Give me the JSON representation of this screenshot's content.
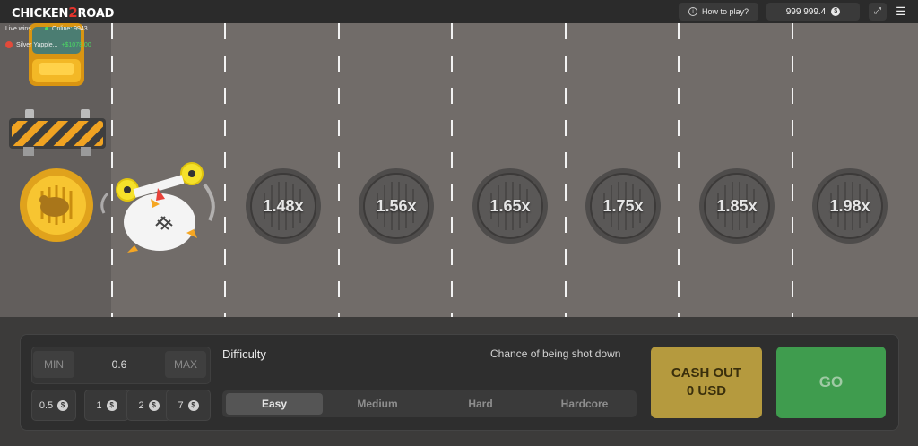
{
  "header": {
    "logo_part1": "CHICKEN",
    "logo_part2": "2",
    "logo_part3": "ROAD",
    "how_to_play": "How to play?",
    "balance": "999 999.4",
    "currency_symbol": "$"
  },
  "live": {
    "label": "Live wins",
    "online": "Online: 9943",
    "wins": [
      {
        "user": "Silver Yapple...",
        "amount": "+$1078.00"
      }
    ]
  },
  "lanes": [
    {
      "multiplier": "1.48x"
    },
    {
      "multiplier": "1.56x"
    },
    {
      "multiplier": "1.65x"
    },
    {
      "multiplier": "1.75x"
    },
    {
      "multiplier": "1.85x"
    },
    {
      "multiplier": "1.98x"
    }
  ],
  "bet": {
    "min_label": "MIN",
    "max_label": "MAX",
    "value": "0.6",
    "chips": [
      "0.5",
      "1",
      "2",
      "7"
    ]
  },
  "difficulty": {
    "label": "Difficulty",
    "chance_label": "Chance of being shot down",
    "options": [
      "Easy",
      "Medium",
      "Hard",
      "Hardcore"
    ],
    "selected": "Easy"
  },
  "actions": {
    "cashout_line1": "CASH OUT",
    "cashout_line2": "0 USD",
    "go": "GO"
  },
  "colors": {
    "road": "#716c69",
    "go_button": "#3f9c4e",
    "cashout_button": "#b59a3e",
    "win_amount": "#4cd964"
  }
}
